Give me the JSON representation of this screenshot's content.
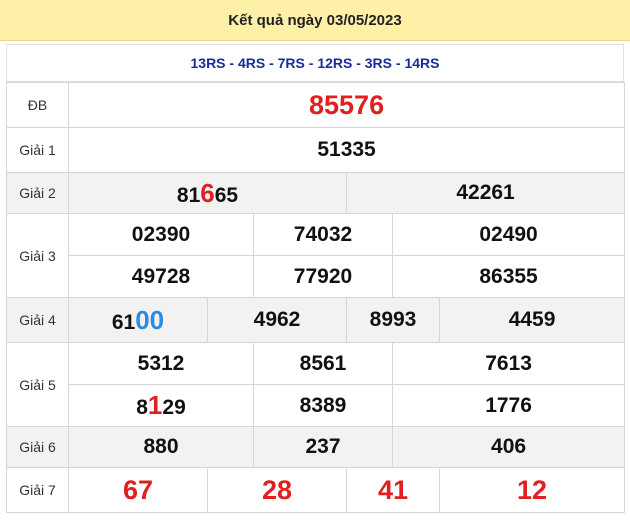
{
  "header": {
    "title": "Kết quả ngày 03/05/2023"
  },
  "codes": "13RS - 4RS - 7RS - 12RS - 3RS - 14RS",
  "rows": {
    "db": {
      "label": "ĐB",
      "value": "85576"
    },
    "g1": {
      "label": "Giải 1",
      "value": "51335"
    },
    "g2": {
      "label": "Giải 2",
      "v1_pre": "81",
      "v1_hl": "6",
      "v1_post": "65",
      "v2": "42261"
    },
    "g3": {
      "label": "Giải 3",
      "values": [
        "02390",
        "74032",
        "02490",
        "49728",
        "77920",
        "86355"
      ]
    },
    "g4": {
      "label": "Giải 4",
      "v1_pre": "61",
      "v1_hl": "00",
      "v2": "4962",
      "v3": "8993",
      "v4": "4459"
    },
    "g5": {
      "label": "Giải 5",
      "v1": "5312",
      "v2": "8561",
      "v3": "7613",
      "v4_pre": "8",
      "v4_hl": "1",
      "v4_post": "29",
      "v5": "8389",
      "v6": "1776"
    },
    "g6": {
      "label": "Giải 6",
      "values": [
        "880",
        "237",
        "406"
      ]
    },
    "g7": {
      "label": "Giải 7",
      "values": [
        "67",
        "28",
        "41",
        "12"
      ]
    }
  },
  "colors": {
    "header_bg": "#fff0a8",
    "codes_text": "#1a2c9c",
    "highlight_red": "#e02020",
    "highlight_blue": "#2a8be0",
    "row_gray": "#f2f2f2"
  }
}
